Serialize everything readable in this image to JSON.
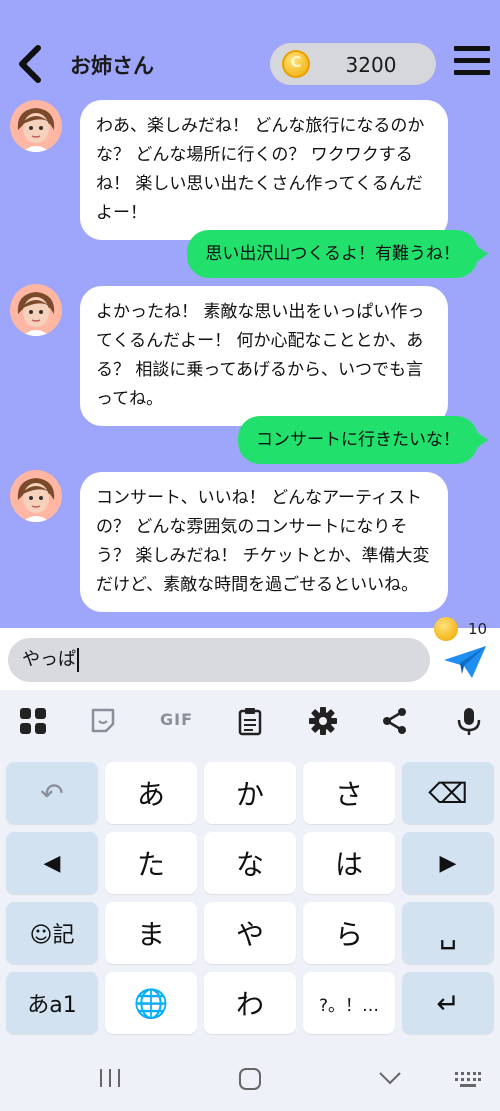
{
  "header": {
    "title": "お姉さん",
    "coins": "3200"
  },
  "messages": [
    {
      "from": "bot",
      "text": "わあ、楽しみだね！ どんな旅行になるのかな？ どんな場所に行くの？ ワクワクするね！ 楽しい思い出たくさん作ってくるんだよー！"
    },
    {
      "from": "user",
      "text": "思い出沢山つくるよ！有難うね！"
    },
    {
      "from": "bot",
      "text": "よかったね！ 素敵な思い出をいっぱい作ってくるんだよー！ 何か心配なこととか、ある？ 相談に乗ってあげるから、いつでも言ってね。"
    },
    {
      "from": "user",
      "text": "コンサートに行きたいな！"
    },
    {
      "from": "bot",
      "text": "コンサート、いいね！ どんなアーティストの？ どんな雰囲気のコンサートになりそう？ 楽しみだね！ チケットとか、準備大変だけど、素敵な時間を過ごせるといいね。"
    }
  ],
  "message_cost": "10",
  "input": {
    "value": "やっぱ"
  },
  "keyboard": {
    "toolbar": {
      "gif": "GIF"
    },
    "rows": [
      [
        "↶",
        "あ",
        "か",
        "さ",
        "⌫"
      ],
      [
        "◀",
        "た",
        "な",
        "は",
        "▶"
      ],
      [
        "☺記",
        "ま",
        "や",
        "ら",
        "␣"
      ],
      [
        "あa1",
        "🌐",
        "わ",
        "?。！…",
        "↵"
      ]
    ]
  }
}
